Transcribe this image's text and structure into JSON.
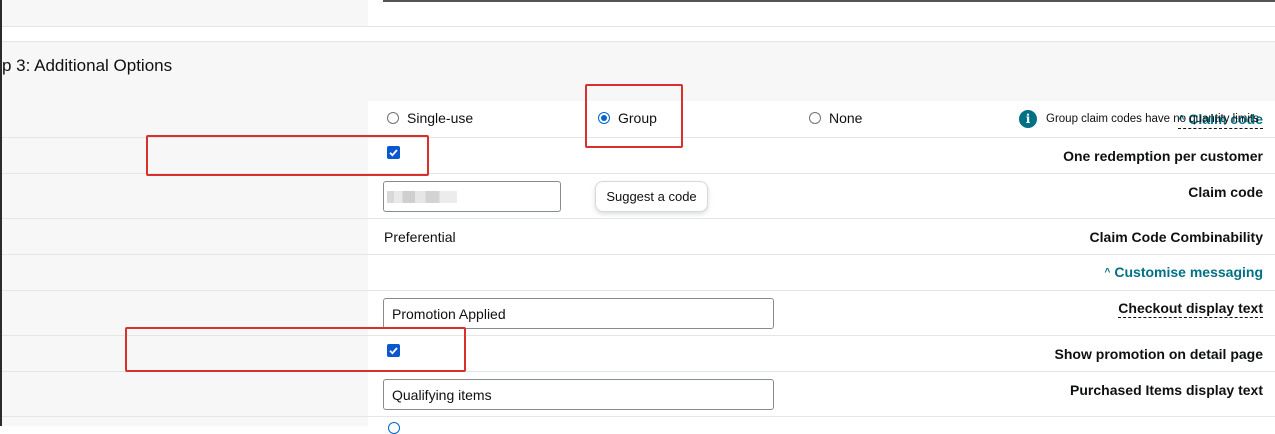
{
  "step": {
    "title": "p 3: Additional Options"
  },
  "claim_code_section": {
    "label": "Claim code",
    "options": [
      {
        "label": "Single-use",
        "selected": false
      },
      {
        "label": "Group",
        "selected": true
      },
      {
        "label": "None",
        "selected": false
      }
    ],
    "info_text": "Group claim codes have no quantity limits"
  },
  "one_redemption": {
    "label": "One redemption per customer",
    "checked": true
  },
  "claim_code_field": {
    "label": "Claim code",
    "value": "",
    "button_label": "Suggest a code"
  },
  "combinability": {
    "label": "Claim Code Combinability",
    "value": "Preferential"
  },
  "customise_messaging": {
    "label": "Customise messaging"
  },
  "checkout_display": {
    "label": "Checkout display text",
    "value": "Promotion Applied"
  },
  "show_promotion": {
    "label": "Show promotion on detail page",
    "checked": true
  },
  "purchased_items": {
    "label": "Purchased Items display text",
    "value": "Qualifying items"
  },
  "colors": {
    "link": "#007185",
    "accent": "#0064d2",
    "highlight": "#d9302c"
  }
}
